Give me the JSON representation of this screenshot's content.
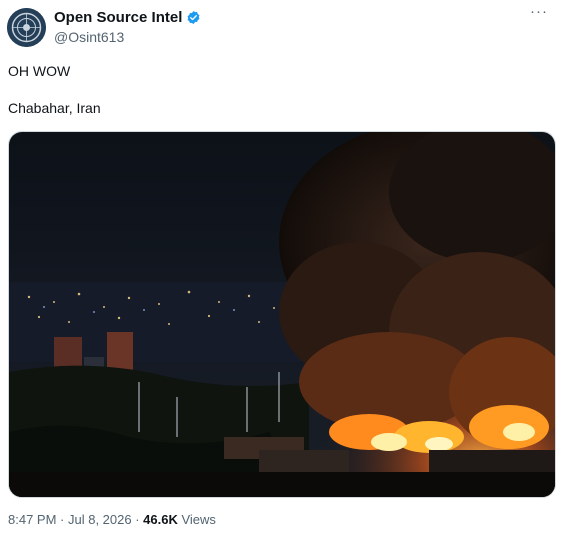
{
  "author": {
    "display_name": "Open Source Intel",
    "handle": "@Osint613",
    "verified": true,
    "badge_color": "#1d9bf0"
  },
  "more_menu": {
    "icon": "more-icon",
    "label": "···"
  },
  "post": {
    "line1": "OH WOW",
    "line2": "Chabahar, Iran"
  },
  "media": {
    "kind": "photo",
    "description_icon": "night-fire-photo"
  },
  "footer": {
    "time": "8:47 PM",
    "separator": " · ",
    "date": "Jul 8, 2026",
    "views_count": "46.6K",
    "views_label": " Views"
  }
}
